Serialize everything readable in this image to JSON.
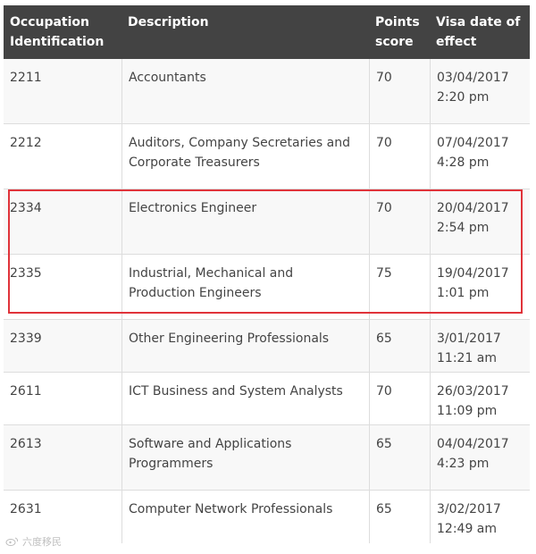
{
  "table": {
    "headers": {
      "occupation": "Occupation Identification",
      "description": "Description",
      "points": "Points score",
      "visa_date": "Visa date of effect"
    },
    "rows": [
      {
        "code": "2211",
        "description": "Accountants",
        "points": "70",
        "date": "03/04/2017",
        "time": "2:20 pm"
      },
      {
        "code": "2212",
        "description": "Auditors, Company Secretaries and Corporate Treasurers",
        "points": "70",
        "date": "07/04/2017",
        "time": "4:28 pm"
      },
      {
        "code": "2334",
        "description": "Electronics Engineer",
        "points": "70",
        "date": "20/04/2017",
        "time": "2:54 pm"
      },
      {
        "code": "2335",
        "description": "Industrial, Mechanical and Production Engineers",
        "points": "75",
        "date": "19/04/2017",
        "time": "1:01 pm"
      },
      {
        "code": "2339",
        "description": "Other Engineering Professionals",
        "points": "65",
        "date": "3/01/2017",
        "time": "11:21 am"
      },
      {
        "code": "2611",
        "description": "ICT Business and System Analysts",
        "points": "70",
        "date": "26/03/2017",
        "time": "11:09 pm"
      },
      {
        "code": "2613",
        "description": "Software and Applications Programmers",
        "points": "65",
        "date": "04/04/2017",
        "time": "4:23 pm"
      },
      {
        "code": "2631",
        "description": "Computer Network Professionals",
        "points": "65",
        "date": "3/02/2017",
        "time": "12:49 am"
      }
    ]
  },
  "highlight": {
    "color": "#e0333a"
  },
  "watermark": {
    "text": "六度移民",
    "icon": "weibo-style-logo-icon"
  }
}
